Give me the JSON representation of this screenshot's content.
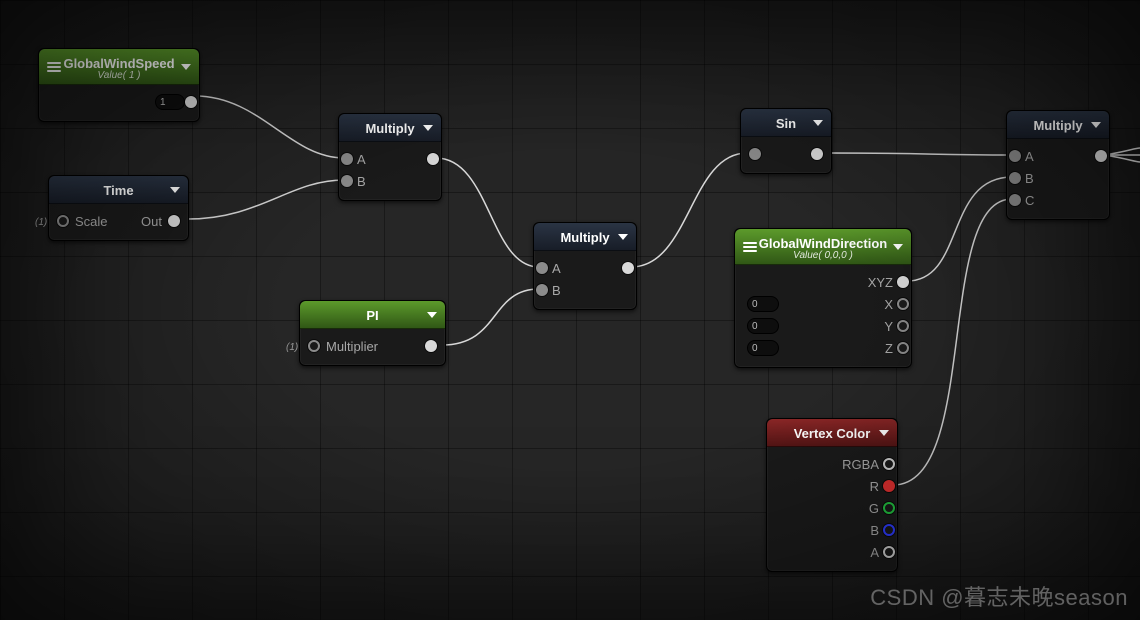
{
  "watermark": "CSDN @暮志未晚season",
  "nodes": {
    "globalWindSpeed": {
      "title": "GlobalWindSpeed",
      "subtitle": "Value( 1 )",
      "value": "1"
    },
    "time": {
      "title": "Time",
      "pins": {
        "scale": "Scale",
        "out": "Out"
      },
      "ext": "(1)"
    },
    "pi": {
      "title": "PI",
      "pins": {
        "multiplier": "Multiplier"
      },
      "ext": "(1)"
    },
    "mult1": {
      "title": "Multiply",
      "pins": {
        "a": "A",
        "b": "B"
      }
    },
    "mult2": {
      "title": "Multiply",
      "pins": {
        "a": "A",
        "b": "B"
      }
    },
    "sin": {
      "title": "Sin"
    },
    "globalWindDirection": {
      "title": "GlobalWindDirection",
      "subtitle": "Value( 0,0,0 )",
      "pins": {
        "xyz": "XYZ",
        "x": "X",
        "y": "Y",
        "z": "Z"
      },
      "values": {
        "x": "0",
        "y": "0",
        "z": "0"
      }
    },
    "vertexColor": {
      "title": "Vertex Color",
      "pins": {
        "rgba": "RGBA",
        "r": "R",
        "g": "G",
        "b": "B",
        "a": "A"
      }
    },
    "mult3": {
      "title": "Multiply",
      "pins": {
        "a": "A",
        "b": "B",
        "c": "C"
      }
    }
  }
}
